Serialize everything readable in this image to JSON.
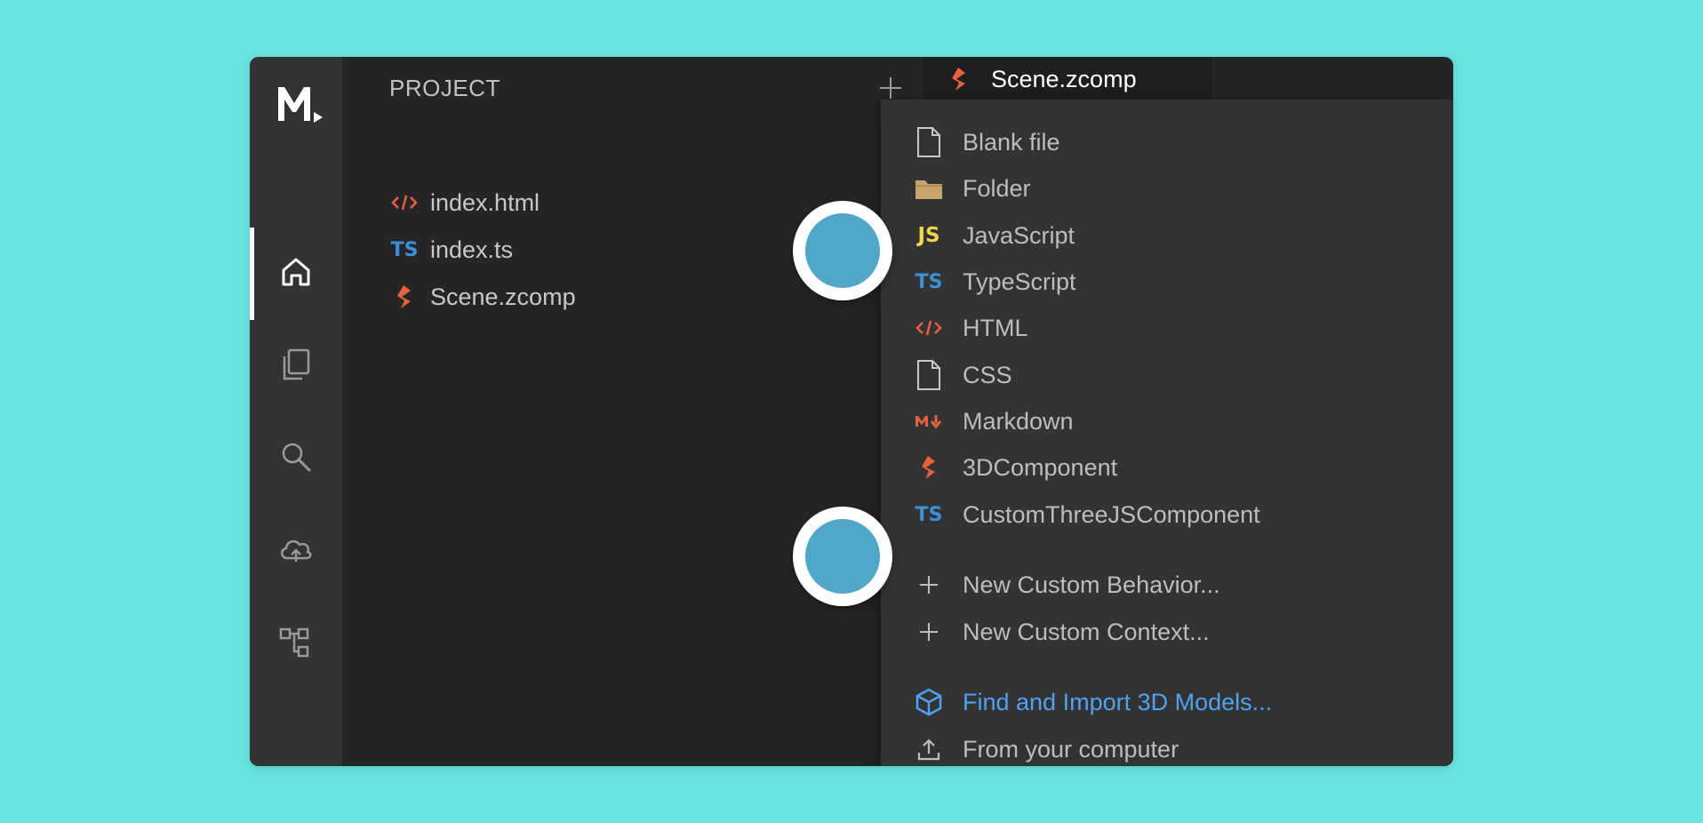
{
  "explorer": {
    "title": "PROJECT",
    "files": [
      {
        "name": "index.html",
        "icon": "html-file-icon"
      },
      {
        "name": "index.ts",
        "icon": "typescript-file-icon"
      },
      {
        "name": "Scene.zcomp",
        "icon": "zcomp-file-icon"
      }
    ]
  },
  "editor": {
    "tab_label": "Scene.zcomp",
    "tab_icon": "zcomp-file-icon"
  },
  "activity_bar": {
    "items": [
      "home-icon",
      "files-icon",
      "search-icon",
      "cloud-upload-icon",
      "hierarchy-icon"
    ],
    "active": "home-icon"
  },
  "glyphs": {
    "ts": "TS",
    "js": "JS"
  },
  "new_file_menu": {
    "items": [
      {
        "label": "Blank file",
        "icon": "blank-file-icon"
      },
      {
        "label": "Folder",
        "icon": "folder-icon"
      },
      {
        "label": "JavaScript",
        "icon": "javascript-icon"
      },
      {
        "label": "TypeScript",
        "icon": "typescript-icon"
      },
      {
        "label": "HTML",
        "icon": "html-icon"
      },
      {
        "label": "CSS",
        "icon": "css-file-icon"
      },
      {
        "label": "Markdown",
        "icon": "markdown-icon"
      },
      {
        "label": "3DComponent",
        "icon": "zcomp-icon"
      },
      {
        "label": "CustomThreeJSComponent",
        "icon": "typescript-icon"
      },
      {
        "label": "New Custom Behavior...",
        "icon": "plus-icon"
      },
      {
        "label": "New Custom Context...",
        "icon": "plus-icon"
      },
      {
        "label": "Find and Import 3D Models...",
        "icon": "cube-icon",
        "accent": true
      },
      {
        "label": "From your computer",
        "icon": "upload-icon"
      }
    ]
  },
  "colors": {
    "background": "#69e4e0",
    "activity_bar": "#333334",
    "panel": "#252526",
    "menu": "#333334",
    "accent_link": "#4ea1f3",
    "zcomp_orange": "#e8613c",
    "ts_blue": "#3d8fd8",
    "js_yellow": "#f1d649",
    "folder_tan": "#c9a46a",
    "marker_blue": "#51a7c7"
  }
}
